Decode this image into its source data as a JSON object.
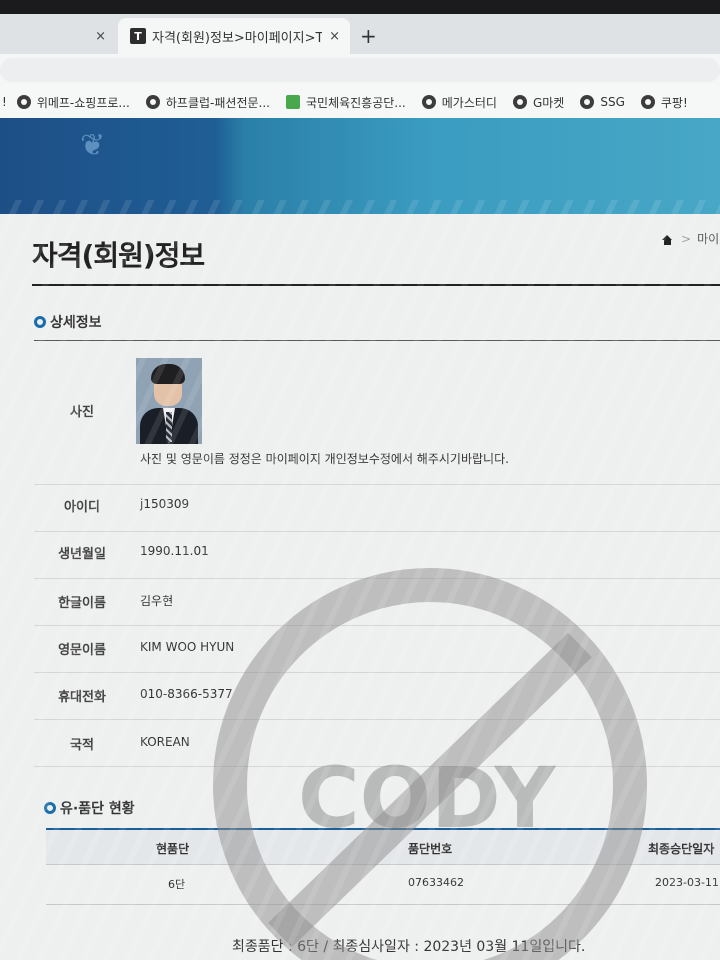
{
  "browser": {
    "tabs": [
      {
        "title": "",
        "close": "×"
      },
      {
        "favicon": "T",
        "title": "자격(회원)정보>마이페이지>To",
        "close": "×"
      }
    ],
    "new_tab": "+",
    "bookmarks": [
      {
        "label": "!",
        "icon": "none"
      },
      {
        "label": "위메프-쇼핑프로...",
        "icon": "globe-icon"
      },
      {
        "label": "하프클럽-패션전문...",
        "icon": "globe-icon"
      },
      {
        "label": "국민체육진흥공단...",
        "icon": "kspo-icon"
      },
      {
        "label": "메가스터디",
        "icon": "globe-icon"
      },
      {
        "label": "G마켓",
        "icon": "globe-icon"
      },
      {
        "label": "SSG",
        "icon": "globe-icon"
      },
      {
        "label": "쿠팡!",
        "icon": "globe-icon"
      }
    ]
  },
  "page": {
    "breadcrumb": {
      "sep": ">",
      "current": "마이"
    },
    "title": "자격(회원)정보",
    "details": {
      "heading": "상세정보",
      "photo_label": "사진",
      "photo_note": "사진 및 영문이름 정정은 마이페이지 개인정보수정에서 해주시기바랍니다.",
      "rows": [
        {
          "label": "아이디",
          "value": "j150309"
        },
        {
          "label": "생년월일",
          "value": "1990.11.01"
        },
        {
          "label": "한글이름",
          "value": "김우현"
        },
        {
          "label": "영문이름",
          "value": "KIM WOO HYUN"
        },
        {
          "label": "휴대전화",
          "value": "010-8366-5377"
        },
        {
          "label": "국적",
          "value": "KOREAN"
        }
      ]
    },
    "grades": {
      "heading": "유·품단 현황",
      "columns": [
        "현품단",
        "품단번호",
        "최종승단일자"
      ],
      "row": [
        "6단",
        "07633462",
        "2023-03-11"
      ]
    },
    "summary": "최종품단 : 6단 / 최종심사일자 : 2023년 03월 11일입니다."
  },
  "watermark": {
    "text": "CODY",
    "color": "#8e8e8e"
  },
  "colors": {
    "banner": "#1f5e95",
    "accent": "#1a6dab"
  }
}
